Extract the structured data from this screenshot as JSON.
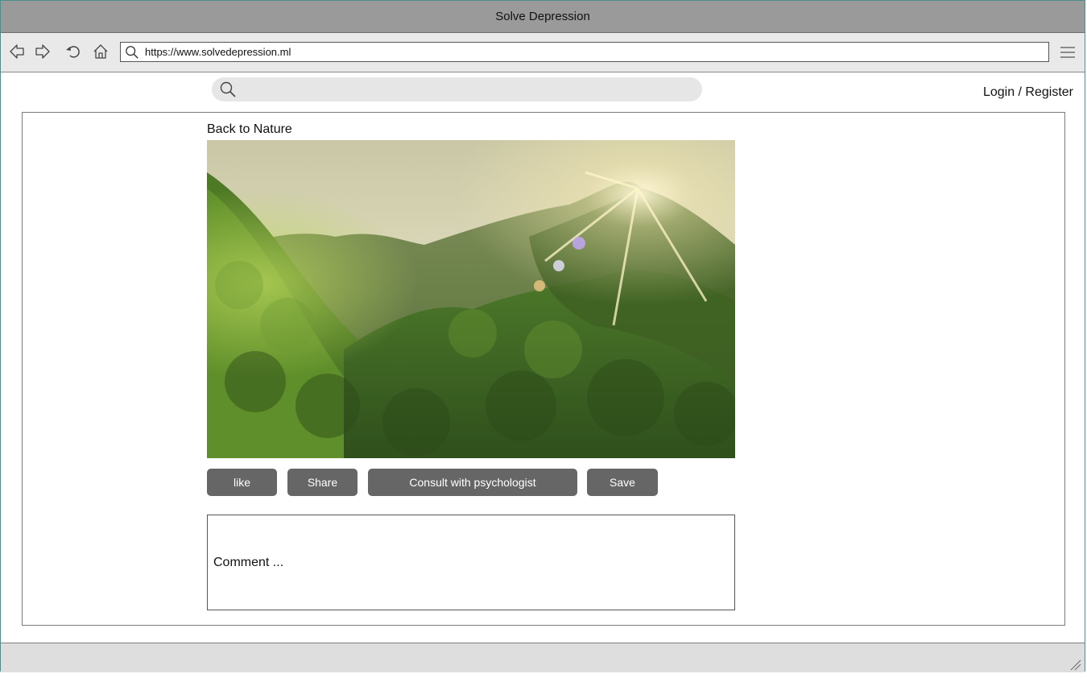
{
  "window": {
    "title": "Solve Depression"
  },
  "toolbar": {
    "icons": [
      "back-arrow-icon",
      "forward-arrow-icon",
      "reload-icon",
      "home-icon",
      "search-icon",
      "hamburger-menu-icon"
    ],
    "url": "https://www.solvedepression.ml"
  },
  "header": {
    "search_placeholder": "",
    "login_label": "Login / Register"
  },
  "post": {
    "title": "Back to Nature",
    "image_alt": "forest mountain sunrise",
    "actions": {
      "like": "like",
      "share": "Share",
      "consult": "Consult with psychologist",
      "save": "Save"
    },
    "comment_placeholder": "Comment ..."
  },
  "colors": {
    "titlebar": "#9a9a9a",
    "toolbar": "#e9e9e9",
    "button": "#666666",
    "search_bg": "#e6e6e6",
    "window_border": "#4b8f8a"
  }
}
